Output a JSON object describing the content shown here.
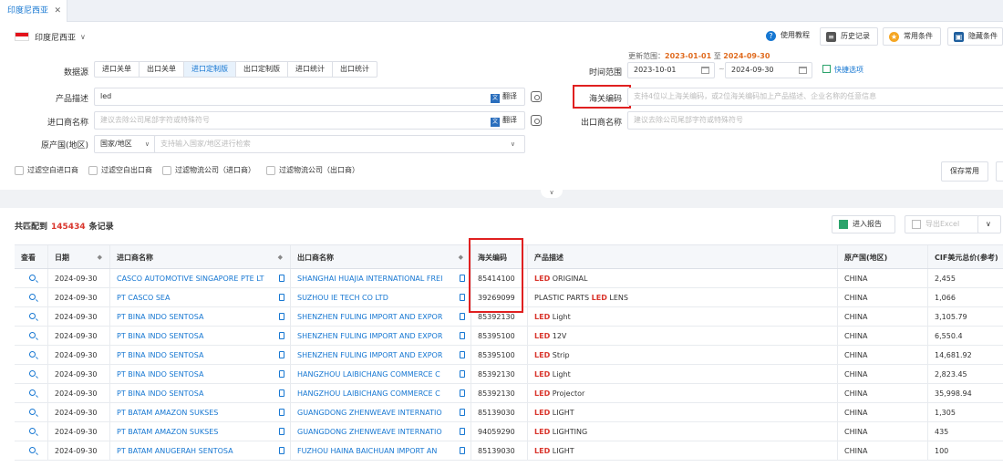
{
  "tab": {
    "title": "印度尼西亚",
    "close": "✕"
  },
  "country": {
    "name": "印度尼西亚"
  },
  "toolbar": {
    "help": "使用教程",
    "history": "历史记录",
    "common": "常用条件",
    "hide": "隐藏条件"
  },
  "range": {
    "label": "更新范围：",
    "from": "2023-01-01",
    "to_word": "至",
    "to": "2024-09-30"
  },
  "source": {
    "label": "数据源",
    "options": [
      "进口关单",
      "出口关单",
      "进口定制版",
      "出口定制版",
      "进口统计",
      "出口统计"
    ],
    "active": "进口定制版"
  },
  "time": {
    "label": "时间范围",
    "from": "2023-10-01",
    "sep": "~",
    "to": "2024-09-30",
    "quick": "快捷选项"
  },
  "product": {
    "label": "产品描述",
    "value": "led",
    "translate": "翻译"
  },
  "hscode": {
    "label": "海关编码",
    "placeholder": "支持4位以上海关编码，或2位海关编码加上产品描述、企业名称的任意信息"
  },
  "importer": {
    "label": "进口商名称",
    "placeholder": "建议去除公司尾部字符或特殊符号",
    "translate": "翻译"
  },
  "exporter": {
    "label": "出口商名称",
    "placeholder": "建议去除公司尾部字符或特殊符号"
  },
  "origin": {
    "label": "原产国(地区)",
    "type": "国家/地区",
    "placeholder": "支持输入国家/地区进行检索"
  },
  "filters": [
    "过滤空白进口商",
    "过滤空白出口商",
    "过滤物流公司（进口商）",
    "过滤物流公司（出口商）"
  ],
  "save": "保存常用",
  "summary": {
    "prefix": "共匹配到",
    "count": "145434",
    "suffix": "条记录"
  },
  "report": "进入报告",
  "export": "导出Excel",
  "table": {
    "headers": [
      "查看",
      "日期",
      "进口商名称",
      "出口商名称",
      "海关编码",
      "产品描述",
      "原产国(地区)",
      "CIF美元总价(参考)"
    ],
    "rows": [
      {
        "date": "2024-09-30",
        "importer": "CASCO AUTOMOTIVE SINGAPORE PTE LT",
        "exporter": "SHANGHAI HUAJIA INTERNATIONAL FREI",
        "hs": "85414100",
        "led": "LED",
        "desc": "ORIGINAL",
        "pre": "",
        "origin": "CHINA",
        "cif": "2,455"
      },
      {
        "date": "2024-09-30",
        "importer": "PT CASCO SEA",
        "exporter": "SUZHOU IE TECH CO LTD",
        "hs": "39269099",
        "pre": "PLASTIC PARTS",
        "led": "LED",
        "desc": "LENS",
        "origin": "CHINA",
        "cif": "1,066"
      },
      {
        "date": "2024-09-30",
        "importer": "PT BINA INDO SENTOSA",
        "exporter": "SHENZHEN FULING IMPORT AND EXPOR",
        "hs": "85392130",
        "pre": "",
        "led": "LED",
        "desc": "Light",
        "origin": "CHINA",
        "cif": "3,105.79"
      },
      {
        "date": "2024-09-30",
        "importer": "PT BINA INDO SENTOSA",
        "exporter": "SHENZHEN FULING IMPORT AND EXPOR",
        "hs": "85395100",
        "pre": "",
        "led": "LED",
        "desc": "12V",
        "origin": "CHINA",
        "cif": "6,550.4"
      },
      {
        "date": "2024-09-30",
        "importer": "PT BINA INDO SENTOSA",
        "exporter": "SHENZHEN FULING IMPORT AND EXPOR",
        "hs": "85395100",
        "pre": "",
        "led": "LED",
        "desc": "Strip",
        "origin": "CHINA",
        "cif": "14,681.92"
      },
      {
        "date": "2024-09-30",
        "importer": "PT BINA INDO SENTOSA",
        "exporter": "HANGZHOU LAIBICHANG COMMERCE C",
        "hs": "85392130",
        "pre": "",
        "led": "LED",
        "desc": "Light",
        "origin": "CHINA",
        "cif": "2,823.45"
      },
      {
        "date": "2024-09-30",
        "importer": "PT BINA INDO SENTOSA",
        "exporter": "HANGZHOU LAIBICHANG COMMERCE C",
        "hs": "85392130",
        "pre": "",
        "led": "LED",
        "desc": "Projector",
        "origin": "CHINA",
        "cif": "35,998.94"
      },
      {
        "date": "2024-09-30",
        "importer": "PT BATAM AMAZON SUKSES",
        "exporter": "GUANGDONG ZHENWEAVE INTERNATIO",
        "hs": "85139030",
        "pre": "",
        "led": "LED",
        "desc": "LIGHT",
        "origin": "CHINA",
        "cif": "1,305"
      },
      {
        "date": "2024-09-30",
        "importer": "PT BATAM AMAZON SUKSES",
        "exporter": "GUANGDONG ZHENWEAVE INTERNATIO",
        "hs": "94059290",
        "pre": "",
        "led": "LED",
        "desc": "LIGHTING",
        "origin": "CHINA",
        "cif": "435"
      },
      {
        "date": "2024-09-30",
        "importer": "PT BATAM ANUGERAH SENTOSA",
        "exporter": "FUZHOU HAINA BAICHUAN IMPORT AN",
        "hs": "85139030",
        "pre": "",
        "led": "LED",
        "desc": "LIGHT",
        "origin": "CHINA",
        "cif": "100"
      }
    ]
  },
  "colors": {
    "accent": "#1677d2",
    "highlight": "#e02020",
    "count": "#d9352c",
    "date": "#e06b1f"
  }
}
